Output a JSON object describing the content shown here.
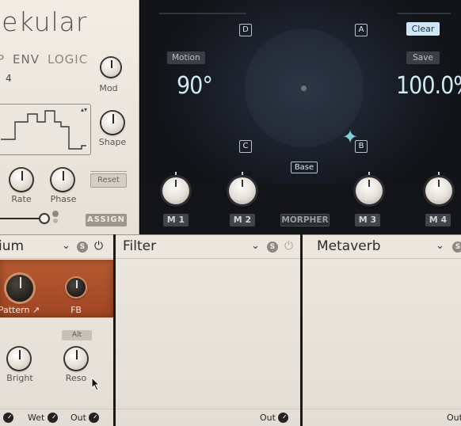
{
  "mod_panel": {
    "logo": "lekular",
    "tabs": [
      "P",
      "ENV",
      "LOGIC"
    ],
    "value": "4",
    "mod_label": "Mod",
    "shape_label": "Shape",
    "rate_label": "Rate",
    "phase_label": "Phase",
    "reset_label": "Reset",
    "assign_label": "ASSIGN",
    "wave_menu": "▴▾"
  },
  "morpher": {
    "corners": [
      "D",
      "A",
      "C",
      "B"
    ],
    "clear_label": "Clear",
    "motion_label": "Motion",
    "save_label": "Save",
    "angle_value": "90°",
    "percent_value": "100.0%",
    "base_label": "Base",
    "macro_labels": [
      "M 1",
      "M 2",
      "M 3",
      "M 4"
    ],
    "morpher_label": "MORPHER",
    "accent_color": "#cfe6f6"
  },
  "slots": [
    {
      "title": "ium",
      "knobs": [
        "Pattern ↗",
        "FB",
        "Bright",
        "Reso"
      ],
      "alt_label": "Alt",
      "footer": [
        "Wet",
        "Out"
      ],
      "accent_color": "#ad522b"
    },
    {
      "title": "Filter",
      "footer": [
        "Out"
      ]
    },
    {
      "title": "Metaverb",
      "footer": [
        "Out"
      ]
    }
  ]
}
